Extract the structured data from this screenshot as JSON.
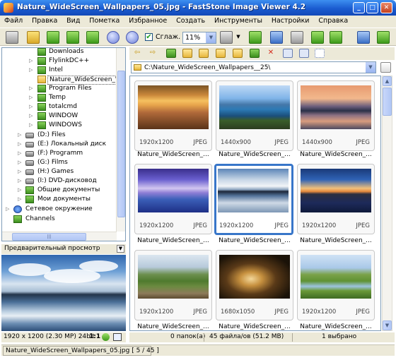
{
  "window": {
    "title": "Nature_WideScreen_Wallpapers_05.jpg  -  FastStone Image Viewer 4.2",
    "minimize_glyph": "_",
    "maximize_glyph": "□",
    "close_glyph": "✕"
  },
  "menu": [
    "Файл",
    "Правка",
    "Вид",
    "Пометка",
    "Избранное",
    "Создать",
    "Инструменты",
    "Настройки",
    "Справка"
  ],
  "toolbar": {
    "smooth_label": "Сглаж.",
    "smooth_checked": "✔",
    "zoom_value": "11%",
    "zoom_arrow": "▼",
    "hand_arrow": "▼"
  },
  "tree": {
    "items": [
      {
        "label": "Downloads",
        "icon": "folder-green-icon",
        "arrow": ""
      },
      {
        "label": "FlylinkDC++",
        "icon": "folder-green-icon",
        "arrow": "▷"
      },
      {
        "label": "Intel",
        "icon": "folder-green-icon",
        "arrow": "▷"
      },
      {
        "label": "Nature_WideScreen_W",
        "icon": "folder-open-icon",
        "arrow": ""
      },
      {
        "label": "Program Files",
        "icon": "folder-green-icon",
        "arrow": "▷"
      },
      {
        "label": "Temp",
        "icon": "folder-green-icon",
        "arrow": "▷"
      },
      {
        "label": "totalcmd",
        "icon": "folder-green-icon",
        "arrow": "▷"
      },
      {
        "label": "WINDOW",
        "icon": "folder-green-icon",
        "arrow": "▷"
      },
      {
        "label": "WINDOWS",
        "icon": "folder-green-icon",
        "arrow": "▷"
      },
      {
        "label": "(D:) Files",
        "icon": "drive-icon",
        "arrow": "▷"
      },
      {
        "label": "(E:) Локальный диск",
        "icon": "drive-icon",
        "arrow": "▷"
      },
      {
        "label": "(F:) Programm",
        "icon": "drive-icon",
        "arrow": "▷"
      },
      {
        "label": "(G:) Films",
        "icon": "drive-icon",
        "arrow": "▷"
      },
      {
        "label": "(H:) Games",
        "icon": "drive-icon",
        "arrow": "▷"
      },
      {
        "label": "(I:) DVD-дисковод",
        "icon": "drive-icon",
        "arrow": "▷"
      },
      {
        "label": "Общие документы",
        "icon": "folder-green-icon",
        "arrow": "▷"
      },
      {
        "label": "Мои документы",
        "icon": "folder-green-icon",
        "arrow": "▷"
      },
      {
        "label": "Сетевое окружение",
        "icon": "network-icon",
        "arrow": "▷"
      },
      {
        "label": "Channels",
        "icon": "folder-green-icon",
        "arrow": ""
      }
    ],
    "hscroll_grip": "|||"
  },
  "preview": {
    "header": "Предварительный просмотр",
    "toggle_glyph": "▼"
  },
  "status_left": {
    "info": "1920 x 1200 (2.30 MP)  24bit",
    "ratio": "1:1"
  },
  "address": {
    "path": "C:\\Nature_WideScreen_Wallpapers__25\\",
    "arrow": "▼"
  },
  "thumbnails": [
    {
      "dims": "1920x1200",
      "fmt": "JPEG",
      "name": "Nature_WideScreen_..."
    },
    {
      "dims": "1440x900",
      "fmt": "JPEG",
      "name": "Nature_WideScreen_..."
    },
    {
      "dims": "1440x900",
      "fmt": "JPEG",
      "name": "Nature_WideScreen_..."
    },
    {
      "dims": "1920x1200",
      "fmt": "JPEG",
      "name": "Nature_WideScreen_..."
    },
    {
      "dims": "1920x1200",
      "fmt": "JPEG",
      "name": "Nature_WideScreen_..."
    },
    {
      "dims": "1920x1200",
      "fmt": "JPEG",
      "name": "Nature_WideScreen_..."
    },
    {
      "dims": "1920x1200",
      "fmt": "JPEG",
      "name": "Nature_WideScreen_..."
    },
    {
      "dims": "1680x1050",
      "fmt": "JPEG",
      "name": "Nature_WideScreen_..."
    },
    {
      "dims": "1920x1200",
      "fmt": "JPEG",
      "name": "Nature_WideScreen_..."
    }
  ],
  "status_right": {
    "folders": "0 папок(а)",
    "files": "45 файла/ов (51.2 MB)",
    "selected": "1 выбрано"
  },
  "status_bottom": {
    "file": "Nature_WideScreen_Wallpapers_05.jpg [ 5 / 45 ]"
  },
  "scroll_glyphs": {
    "up": "▲",
    "down": "▼"
  },
  "nav_glyphs": {
    "back": "⇦",
    "forward": "⇨",
    "delete": "✕"
  }
}
